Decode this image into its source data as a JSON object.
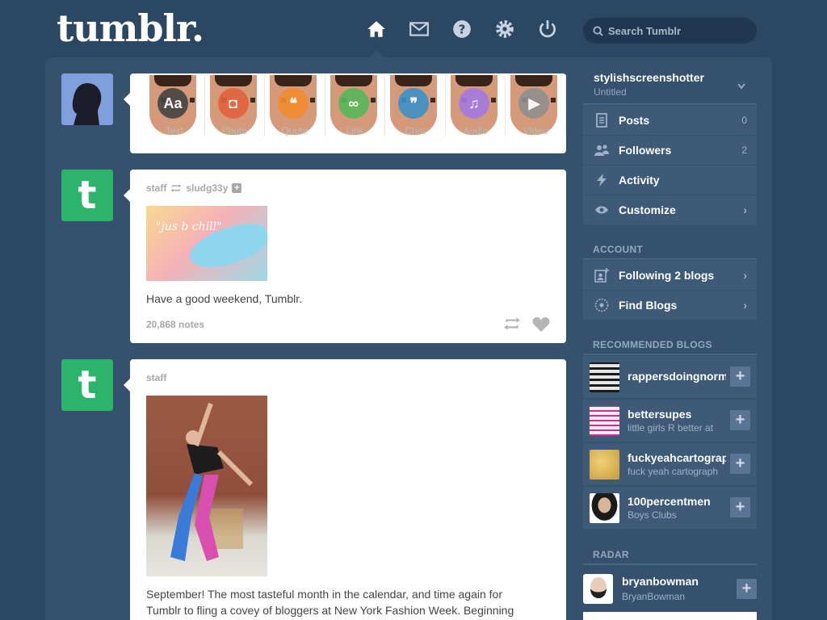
{
  "header": {
    "logo": "tumblr.",
    "nav": [
      "home-icon",
      "mail-icon",
      "help-icon",
      "gear-icon",
      "power-icon"
    ],
    "search_placeholder": "Search Tumblr"
  },
  "post_types": [
    {
      "label": "Text",
      "glyph": "Aa",
      "color": "#444444"
    },
    {
      "label": "Photo",
      "glyph": "◘",
      "color": "#e5613e"
    },
    {
      "label": "Quote",
      "glyph": "❝",
      "color": "#f28c2f"
    },
    {
      "label": "Link",
      "glyph": "∞",
      "color": "#56b85a"
    },
    {
      "label": "Chat",
      "glyph": "❞",
      "color": "#3b91c9"
    },
    {
      "label": "Audio",
      "glyph": "♫",
      "color": "#a57ae0"
    },
    {
      "label": "Video",
      "glyph": "▶",
      "color": "#8f8f8f"
    }
  ],
  "posts": [
    {
      "author": "staff",
      "reblog_from": "sludg33y",
      "image_caption": "\"jus b chill\"",
      "text": "Have a good weekend, Tumblr.",
      "notes": "20,868 notes"
    },
    {
      "author": "staff",
      "text_line1": "September! The most tasteful month in the calendar, and time again for",
      "text_line2": "Tumblr to fling a covey of bloggers at New York Fashion Week. Beginning"
    }
  ],
  "sidebar": {
    "blog": {
      "name": "stylishscreenshotter",
      "subtitle": "Untitled"
    },
    "items": [
      {
        "label": "Posts",
        "count": "0"
      },
      {
        "label": "Followers",
        "count": "2"
      },
      {
        "label": "Activity"
      },
      {
        "label": "Customize",
        "chevron": "›"
      }
    ],
    "account_heading": "ACCOUNT",
    "account_items": [
      {
        "label": "Following 2 blogs",
        "chevron": "›"
      },
      {
        "label": "Find Blogs",
        "chevron": "›"
      }
    ],
    "recommended_heading": "RECOMMENDED BLOGS",
    "recommended": [
      {
        "name": "rappersdoingnormalshit",
        "desc": "",
        "thumb_color": "#dcdcdc"
      },
      {
        "name": "bettersupes",
        "desc": "little girls R better at",
        "thumb_color": "#f4f0f4"
      },
      {
        "name": "fuckyeahcartography",
        "desc": "fuck yeah cartograph",
        "thumb_color": "#d9b24a"
      },
      {
        "name": "100percentmen",
        "desc": "Boys Clubs",
        "thumb_color": "#ffffff"
      }
    ],
    "radar_heading": "RADAR",
    "radar": {
      "name": "bryanbowman",
      "desc": "BryanBowman"
    },
    "plus": "+"
  }
}
